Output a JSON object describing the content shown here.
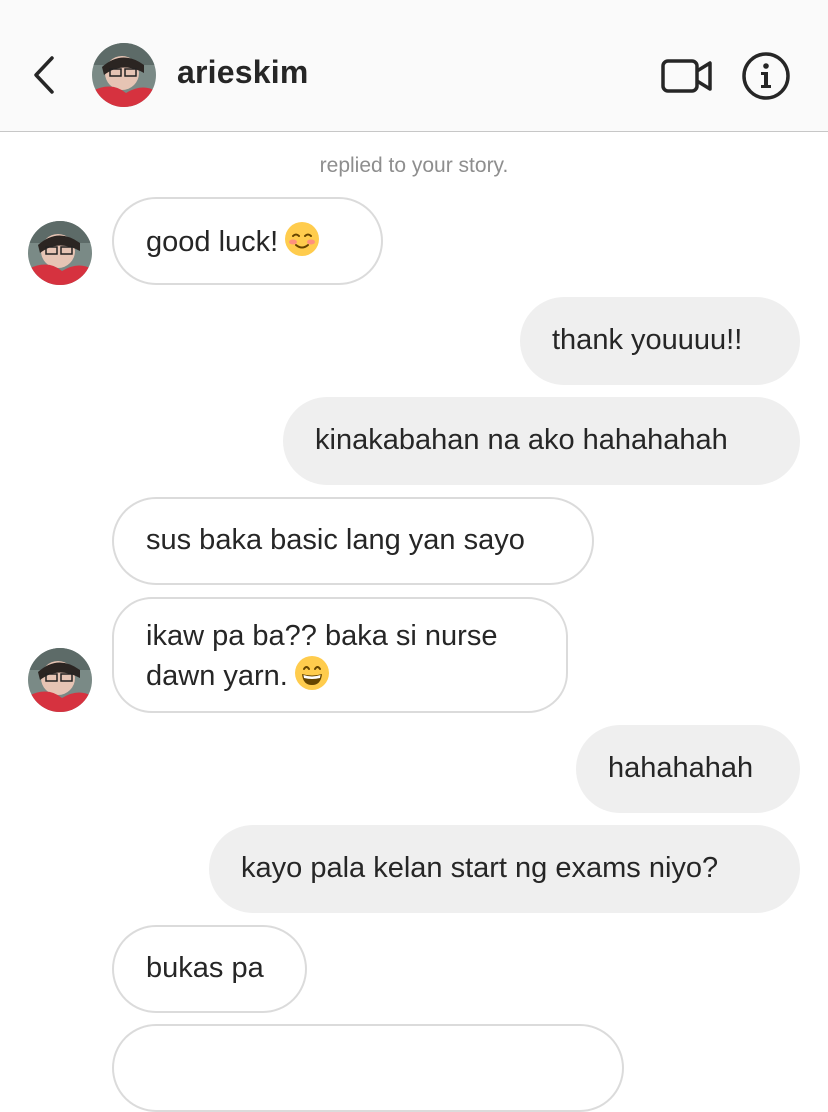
{
  "header": {
    "username": "arieskim",
    "back_icon": "chevron-left-icon",
    "video_icon": "video-camera-icon",
    "info_icon": "info-icon"
  },
  "conversation": {
    "context_note": "replied to your story.",
    "messages": [
      {
        "direction": "incoming",
        "text": "good luck!",
        "emoji": "smiling-blush-emoji",
        "show_avatar": true
      },
      {
        "direction": "outgoing",
        "text": "thank youuuu!!"
      },
      {
        "direction": "outgoing",
        "text": "kinakabahan na ako hahahahah"
      },
      {
        "direction": "incoming",
        "text": "sus baka basic lang yan sayo"
      },
      {
        "direction": "incoming",
        "line1": "ikaw pa ba?? baka si nurse",
        "line2": "dawn yarn.",
        "emoji": "grinning-emoji",
        "show_avatar": true
      },
      {
        "direction": "outgoing",
        "text": "hahahahah"
      },
      {
        "direction": "outgoing",
        "text": "kayo pala kelan start ng exams niyo?"
      },
      {
        "direction": "incoming",
        "text": "bukas pa"
      }
    ]
  },
  "colors": {
    "header_bg": "#fafafa",
    "outgoing_bubble": "#efefef",
    "incoming_border": "#dbdbdb",
    "muted_text": "#8e8e8e"
  }
}
